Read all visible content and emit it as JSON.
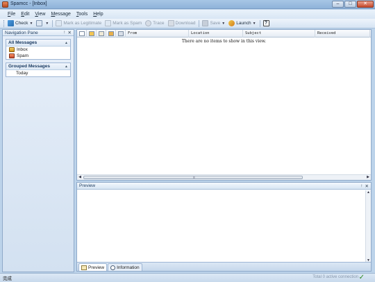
{
  "window": {
    "title": "Spamcc - [Inbox]",
    "minimize": "–",
    "maximize": "□",
    "close": "✕"
  },
  "menu": [
    "File",
    "Edit",
    "View",
    "Message",
    "Tools",
    "Help"
  ],
  "toolbar": {
    "check": "Check",
    "mark_legitimate": "Mark as Legitimate",
    "mark_spam": "Mark as Spam",
    "trace": "Trace",
    "download": "Download",
    "save": "Save",
    "launch": "Launch",
    "help_glyph": "?"
  },
  "nav": {
    "title": "Navigation Pane",
    "pin": "↑",
    "close": "✕",
    "all_messages": {
      "title": "All Messages",
      "items": [
        "Inbox",
        "Spam"
      ]
    },
    "grouped": {
      "title": "Grouped Messages",
      "items": [
        "Today"
      ]
    }
  },
  "list": {
    "columns": [
      "From",
      "Location",
      "Subject",
      "Received"
    ],
    "empty_text": "There are no items to show in this view."
  },
  "preview": {
    "title": "Preview",
    "tabs": [
      "Preview",
      "Information"
    ]
  },
  "status": {
    "left": "完成",
    "right": "Total 0 active connection"
  }
}
